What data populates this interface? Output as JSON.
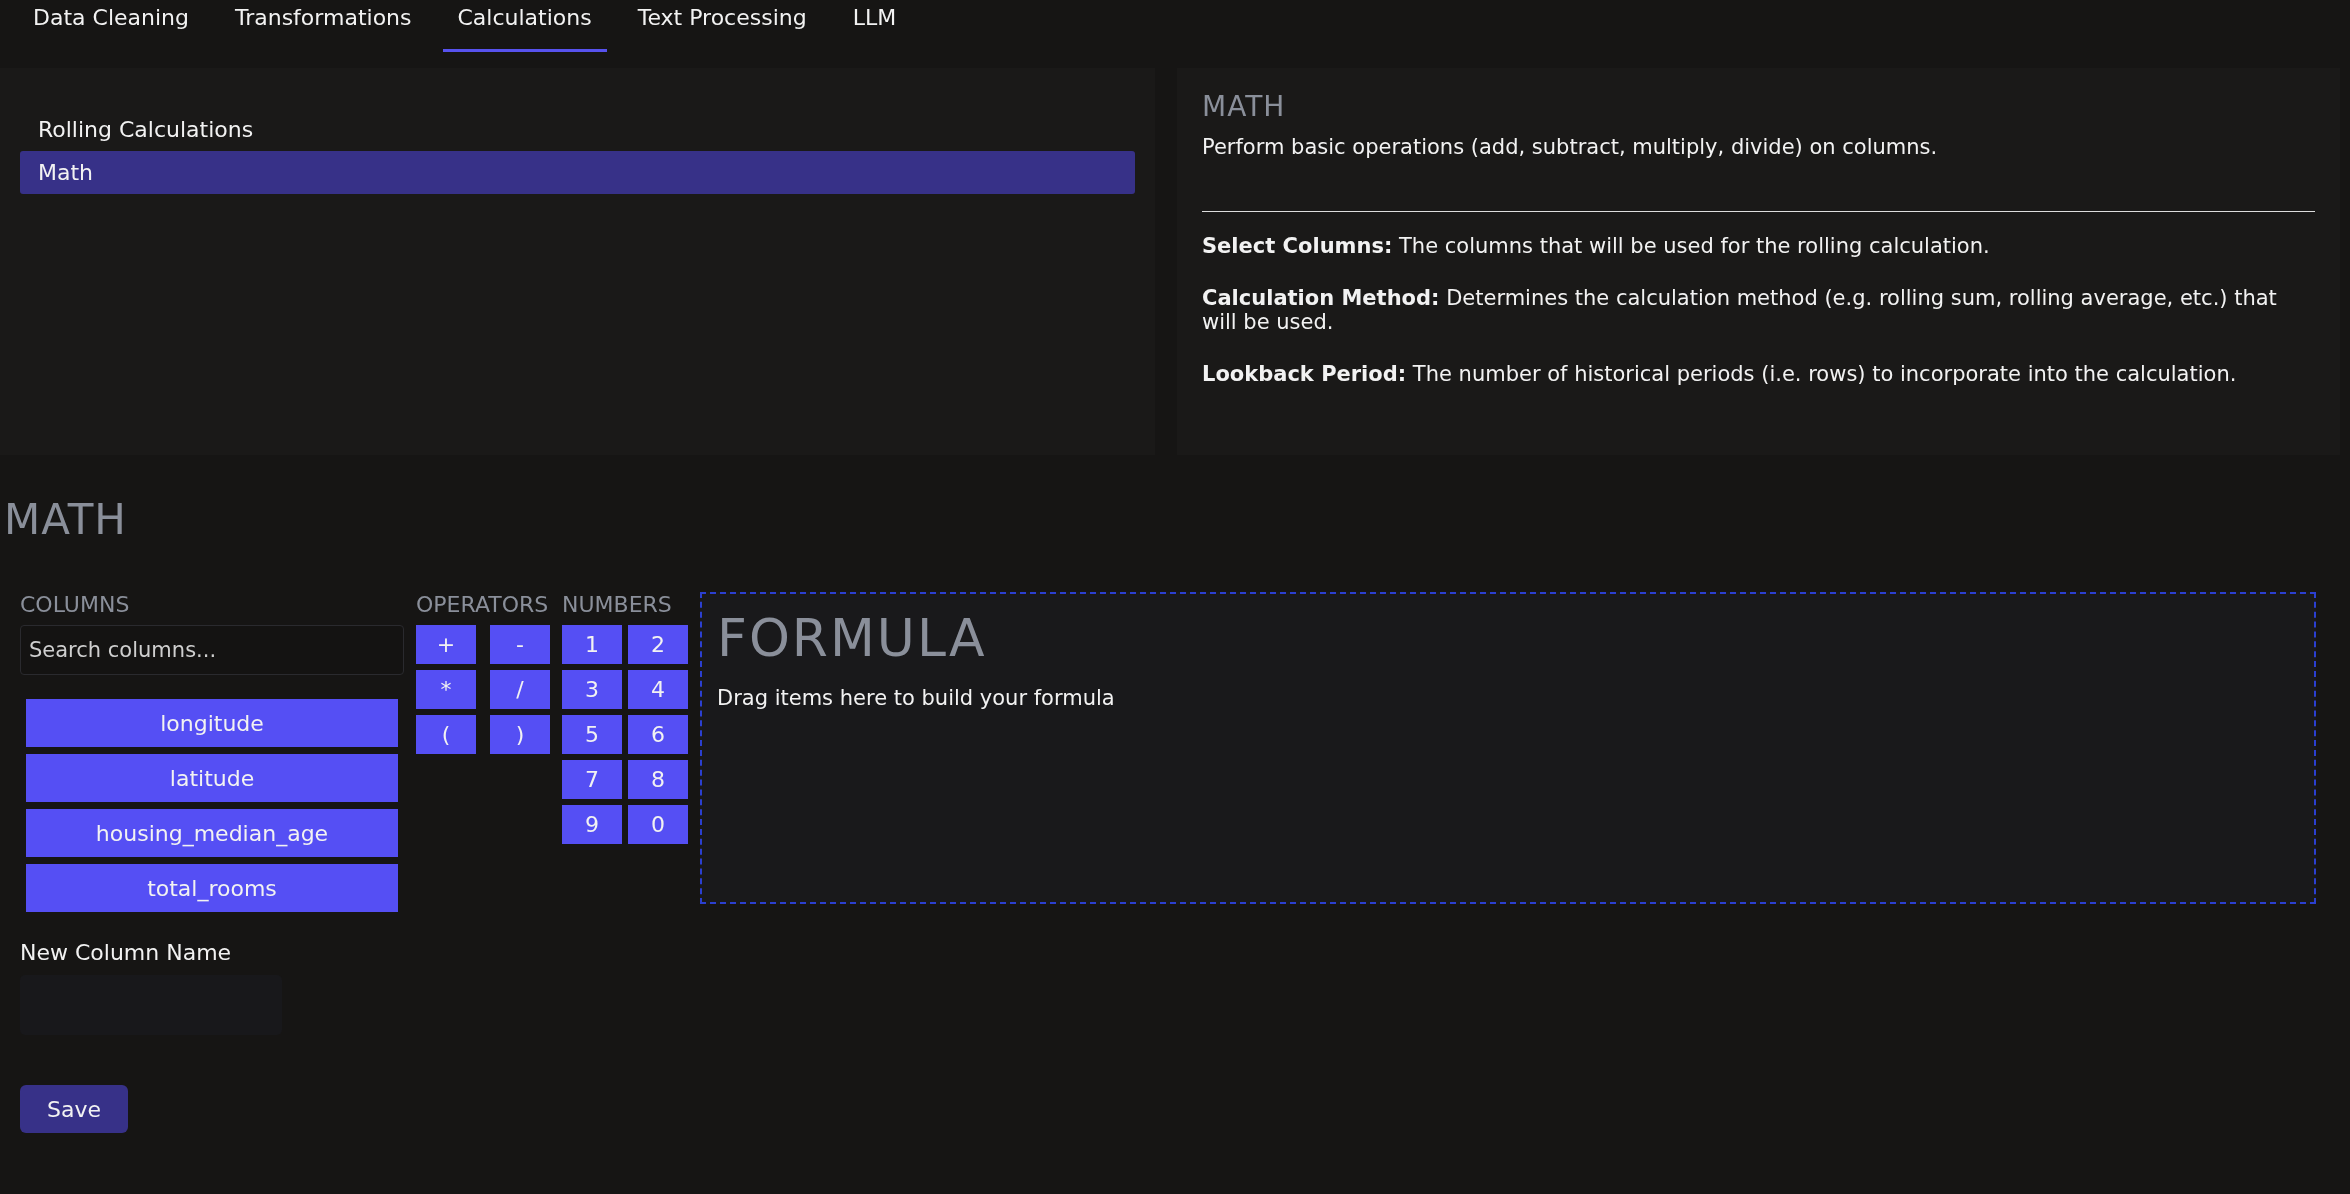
{
  "tabs": [
    {
      "label": "Data Cleaning",
      "selected": false
    },
    {
      "label": "Transformations",
      "selected": false
    },
    {
      "label": "Calculations",
      "selected": true
    },
    {
      "label": "Text Processing",
      "selected": false
    },
    {
      "label": "LLM",
      "selected": false
    }
  ],
  "sidebar": {
    "items": [
      {
        "label": "Rolling Calculations",
        "selected": false
      },
      {
        "label": "Math",
        "selected": true
      }
    ]
  },
  "info": {
    "title": "MATH",
    "description": "Perform basic operations (add, subtract, multiply, divide) on columns.",
    "details": [
      "**Select Columns:** The columns that will be used for the rolling calculation.",
      "**Calculation Method:** Determines the calculation method (e.g. rolling sum, rolling average, etc.) that will be used.",
      "**Lookback Period:** The number of historical periods (i.e. rows) to incorporate into the calculation."
    ]
  },
  "section_title": "MATH",
  "columns": {
    "title": "COLUMNS",
    "search": {
      "placeholder": "Search columns..."
    },
    "items": [
      "longitude",
      "latitude",
      "housing_median_age",
      "total_rooms"
    ]
  },
  "operators": {
    "title": "OPERATORS",
    "items": [
      "+",
      "-",
      "*",
      "/",
      "(",
      ")"
    ]
  },
  "numbers": {
    "title": "NUMBERS",
    "items": [
      "1",
      "2",
      "3",
      "4",
      "5",
      "6",
      "7",
      "8",
      "9",
      "0"
    ]
  },
  "formula": {
    "title": "FORMULA",
    "hint": "Drag items here to build your formula"
  },
  "new_column": {
    "label": "New Column Name"
  },
  "save_button": "Save"
}
